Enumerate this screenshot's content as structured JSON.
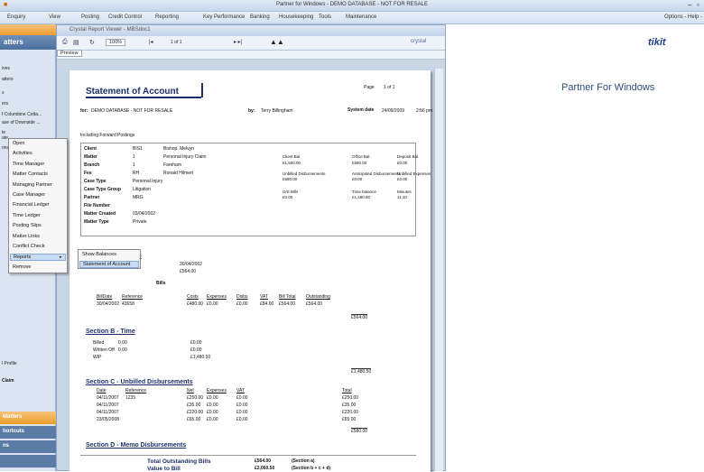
{
  "app": {
    "title": "Partner for Windows - DEMO DATABASE - NOT FOR RESALE",
    "right_title": "Partner For Windows",
    "options": "Options - Help -",
    "brand": "tikit"
  },
  "menu": [
    "Enquiry",
    "View",
    "Posting",
    "Credit Control",
    "Reporting",
    "Key Performance",
    "Banking",
    "Housekeeping",
    "Tools",
    "Maintenance"
  ],
  "left": {
    "head": "atters",
    "items": [
      "ives",
      "atters",
      "s",
      "ers",
      "f Columbine Cotta...",
      "ase of Downside ...",
      "te",
      "ate",
      "onal Injury"
    ],
    "bottom_a": "l Profile",
    "bottom_b": "Claim",
    "tabs": [
      "Matters",
      "hortcuts",
      "ns"
    ]
  },
  "context_menu": {
    "items": [
      "Open",
      "Activities",
      "Time Manager",
      "Matter Contacts",
      "Managing Partner",
      "Case Manager",
      "Financial Ledger",
      "Time Ledger",
      "Posting Slips",
      "Matter Links",
      "Conflict Check",
      "Reports",
      "Remove"
    ],
    "highlighted": "Reports"
  },
  "submenu": {
    "items": [
      "Show Balances",
      "Statement of Account"
    ]
  },
  "viewer": {
    "title": "Crystal Report Viewer - MBSdoc1",
    "zoom": "100%",
    "page_nav": "1 of 1",
    "brand": "crystal",
    "preview_tab": "Preview"
  },
  "report": {
    "title": "Statement of Account",
    "page_label": "Page",
    "page_value": "1 of 1",
    "for_label": "for:",
    "for_value": "DEMO DATABASE - NOT FOR RESALE",
    "by_label": "by:",
    "by_value": "Terry Billingham",
    "sysdate_label": "System date",
    "sysdate_value": "24/09/2009",
    "sysdate_time": "2:56 pm",
    "including": "Including Forward Postings",
    "client": [
      [
        "Client",
        "BIS1",
        "Bishop, Melvyn"
      ],
      [
        "Matter",
        "1",
        "Personal Injury Claim"
      ],
      [
        "Branch",
        "1",
        "Fareham"
      ],
      [
        "Fee",
        "RH",
        "Ronald Hilmert"
      ],
      [
        "Case Type",
        "Personal Injury",
        ""
      ],
      [
        "Case Type Group",
        "Litigation",
        ""
      ],
      [
        "Partner",
        "MRG",
        ""
      ],
      [
        "File Number",
        "",
        ""
      ],
      [
        "Matter Created",
        "03/04/2002",
        ""
      ],
      [
        "Matter Type",
        "Private",
        ""
      ]
    ],
    "balances": [
      [
        "Client Bal",
        "Office Bal",
        "Deposit Bal"
      ],
      [
        "£1,500.00",
        "£590.00",
        "£0.00"
      ],
      [
        "Unbilled Disbursements",
        "Anticipated Disbursements",
        "Unbilled Expenses"
      ],
      [
        "£580.00",
        "£0.00",
        "£0.00"
      ],
      [
        "O/S Bills",
        "Time balance",
        "Minutes"
      ],
      [
        "£0.00",
        "£1,480.50",
        "11:10"
      ]
    ],
    "billing_head": "Billing Information",
    "billing": [
      [
        "Last Bill Date",
        "30/04/2002"
      ],
      [
        "",
        "£564.00"
      ]
    ],
    "bills_head": "Bills",
    "bills_cols": [
      "BillDate",
      "Reference",
      "Costs",
      "Expenses",
      "Disbs",
      "VAT",
      "Bill Total",
      "Outstanding"
    ],
    "bills_row": [
      "30/04/2002",
      "43658",
      "£480.00",
      "£0.00",
      "£0.00",
      "£84.00",
      "£564.00",
      "£564.00"
    ],
    "bills_total": "£564.00",
    "secB_head": "Section B - Time",
    "secB": [
      [
        "Billed",
        "0.00",
        "£0.00"
      ],
      [
        "Written Off",
        "0.00",
        "£0.00"
      ],
      [
        "WIP",
        "",
        "£1,480.50"
      ]
    ],
    "secB_total": "£1,480.50",
    "secC_head": "Section C - Unbilled Disbursements",
    "secC_cols": [
      "Date",
      "Reference",
      "Net",
      "Expenses",
      "VAT",
      "Total"
    ],
    "secC_rows": [
      [
        "04/11/2007",
        "1235",
        "£250.00",
        "£0.00",
        "£0.00",
        "£250.00"
      ],
      [
        "04/11/2007",
        "",
        "£35.00",
        "£0.00",
        "£0.00",
        "£35.00"
      ],
      [
        "04/11/2007",
        "",
        "£220.00",
        "£0.00",
        "£0.00",
        "£220.00"
      ],
      [
        "23/05/2008",
        "",
        "£65.00",
        "£0.00",
        "£0.00",
        "£65.00"
      ]
    ],
    "secC_total": "£580.00",
    "secD_head": "Section D - Memo Disbursements",
    "totals": [
      [
        "Total Outstanding Bills",
        "£564.00",
        "(Section a)"
      ],
      [
        "Value to Bill",
        "£2,060.50",
        "(Section b + c + d)"
      ]
    ]
  }
}
